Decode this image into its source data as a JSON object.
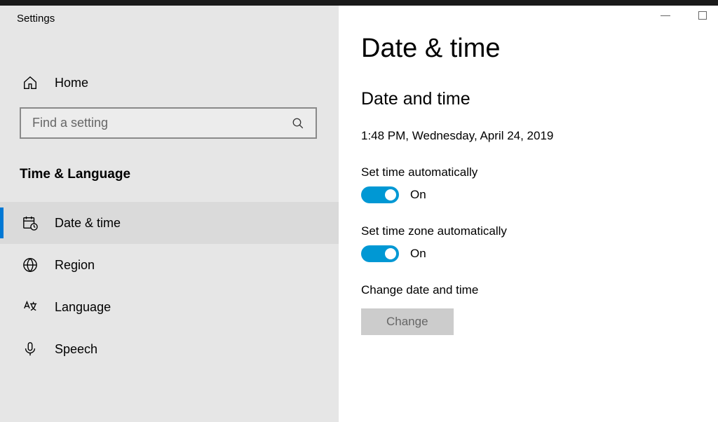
{
  "window": {
    "title": "Settings"
  },
  "sidebar": {
    "home_label": "Home",
    "search_placeholder": "Find a setting",
    "category": "Time & Language",
    "items": [
      {
        "label": "Date & time",
        "icon": "calendar-clock-icon",
        "active": true
      },
      {
        "label": "Region",
        "icon": "globe-icon",
        "active": false
      },
      {
        "label": "Language",
        "icon": "language-icon",
        "active": false
      },
      {
        "label": "Speech",
        "icon": "microphone-icon",
        "active": false
      }
    ]
  },
  "main": {
    "title": "Date & time",
    "section_title": "Date and time",
    "current_datetime": "1:48 PM, Wednesday, April 24, 2019",
    "set_time_auto": {
      "label": "Set time automatically",
      "state": "On"
    },
    "set_tz_auto": {
      "label": "Set time zone automatically",
      "state": "On"
    },
    "change": {
      "label": "Change date and time",
      "button": "Change"
    }
  }
}
